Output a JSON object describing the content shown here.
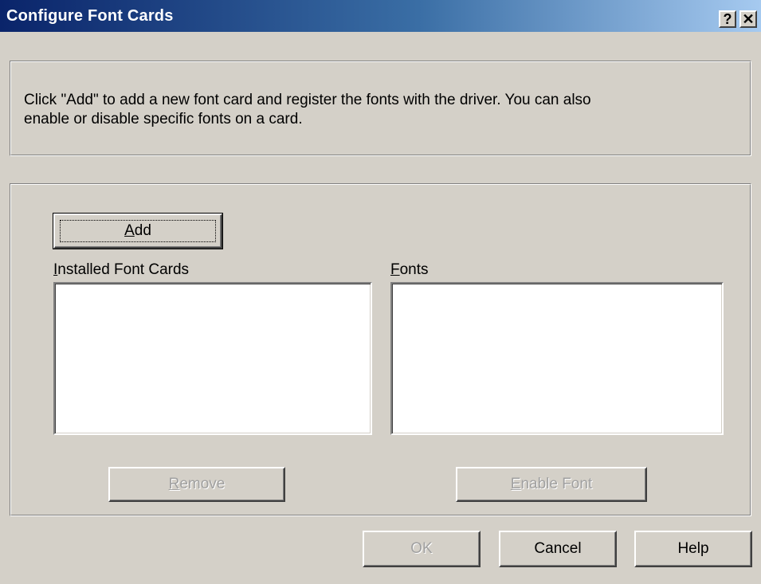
{
  "window": {
    "title": "Configure Font Cards",
    "help_glyph": "?",
    "close_glyph": "✕",
    "help_icon": "help-question-icon",
    "close_icon": "close-x-icon"
  },
  "info": {
    "line1": "Click \"Add\" to add a new font card and register the fonts with the driver.  You can also",
    "line2": "enable or disable specific fonts on a card."
  },
  "cards": {
    "add_label_mnemonic": "A",
    "add_label_rest": "dd",
    "installed_label_mnemonic": "I",
    "installed_label_rest": "nstalled Font Cards",
    "fonts_label_mnemonic": "F",
    "fonts_label_rest": "onts",
    "installed_items": [],
    "fonts_items": [],
    "remove_label_mnemonic": "R",
    "remove_label_rest": "emove",
    "enable_label_mnemonic": "E",
    "enable_label_rest": "nable Font"
  },
  "footer": {
    "ok_label": "OK",
    "cancel_label": "Cancel",
    "help_label": "Help"
  }
}
